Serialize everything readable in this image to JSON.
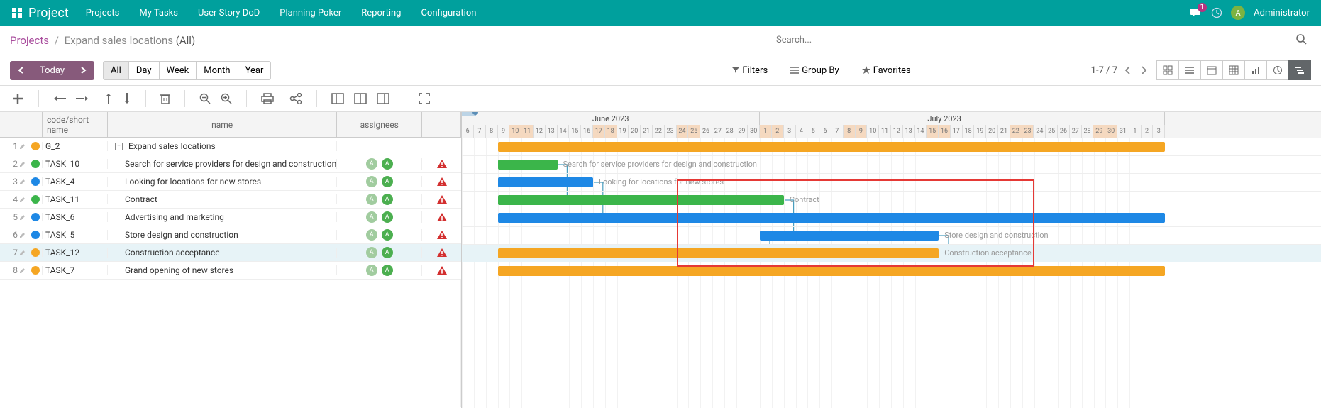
{
  "app": {
    "name": "Project"
  },
  "nav": {
    "links": [
      "Projects",
      "My Tasks",
      "User Story DoD",
      "Planning Poker",
      "Reporting",
      "Configuration"
    ],
    "msg_count": "1",
    "user_initial": "A",
    "user_name": "Administrator"
  },
  "breadcrumb": {
    "root": "Projects",
    "current": "Expand sales locations",
    "suffix": "(All)"
  },
  "search": {
    "placeholder": "Search..."
  },
  "controls": {
    "today": "Today",
    "ranges": [
      "All",
      "Day",
      "Week",
      "Month",
      "Year"
    ],
    "filters": "Filters",
    "groupby": "Group By",
    "favorites": "Favorites",
    "pager": "1-7 / 7"
  },
  "columns": {
    "code": "code/short name",
    "name": "name",
    "assignees": "assignees"
  },
  "months": [
    {
      "label": "June 2023",
      "days": 25
    },
    {
      "label": "July 2023",
      "days": 31
    },
    {
      "label": "",
      "days": 3
    }
  ],
  "timeline_start_day_label": "6",
  "days": [
    {
      "n": "6",
      "w": false
    },
    {
      "n": "7",
      "w": false
    },
    {
      "n": "8",
      "w": false
    },
    {
      "n": "9",
      "w": false
    },
    {
      "n": "10",
      "w": true
    },
    {
      "n": "11",
      "w": true
    },
    {
      "n": "12",
      "w": false
    },
    {
      "n": "13",
      "w": false
    },
    {
      "n": "14",
      "w": false
    },
    {
      "n": "15",
      "w": false
    },
    {
      "n": "16",
      "w": false
    },
    {
      "n": "17",
      "w": true
    },
    {
      "n": "18",
      "w": true
    },
    {
      "n": "19",
      "w": false
    },
    {
      "n": "20",
      "w": false
    },
    {
      "n": "21",
      "w": false
    },
    {
      "n": "22",
      "w": false
    },
    {
      "n": "23",
      "w": false
    },
    {
      "n": "24",
      "w": true
    },
    {
      "n": "25",
      "w": true
    },
    {
      "n": "26",
      "w": false
    },
    {
      "n": "27",
      "w": false
    },
    {
      "n": "28",
      "w": false
    },
    {
      "n": "29",
      "w": false
    },
    {
      "n": "30",
      "w": false
    },
    {
      "n": "1",
      "w": true
    },
    {
      "n": "2",
      "w": true
    },
    {
      "n": "3",
      "w": false
    },
    {
      "n": "4",
      "w": false
    },
    {
      "n": "5",
      "w": false
    },
    {
      "n": "6",
      "w": false
    },
    {
      "n": "7",
      "w": false
    },
    {
      "n": "8",
      "w": true
    },
    {
      "n": "9",
      "w": true
    },
    {
      "n": "10",
      "w": false
    },
    {
      "n": "11",
      "w": false
    },
    {
      "n": "12",
      "w": false
    },
    {
      "n": "13",
      "w": false
    },
    {
      "n": "14",
      "w": false
    },
    {
      "n": "15",
      "w": true
    },
    {
      "n": "16",
      "w": true
    },
    {
      "n": "17",
      "w": false
    },
    {
      "n": "18",
      "w": false
    },
    {
      "n": "19",
      "w": false
    },
    {
      "n": "20",
      "w": false
    },
    {
      "n": "21",
      "w": false
    },
    {
      "n": "22",
      "w": true
    },
    {
      "n": "23",
      "w": true
    },
    {
      "n": "24",
      "w": false
    },
    {
      "n": "25",
      "w": false
    },
    {
      "n": "26",
      "w": false
    },
    {
      "n": "27",
      "w": false
    },
    {
      "n": "28",
      "w": false
    },
    {
      "n": "29",
      "w": true
    },
    {
      "n": "30",
      "w": true
    },
    {
      "n": "31",
      "w": false
    },
    {
      "n": "1",
      "w": false
    },
    {
      "n": "2",
      "w": false
    },
    {
      "n": "3",
      "w": false
    }
  ],
  "rows": [
    {
      "idx": "1",
      "dot": "orange",
      "code": "G_2",
      "name": "Expand sales locations",
      "is_group": true,
      "assignees": [],
      "alert": false,
      "bar": {
        "color": "orange",
        "start": 3,
        "end": 59,
        "full": true
      }
    },
    {
      "idx": "2",
      "dot": "green",
      "code": "TASK_10",
      "name": "Search for service providers for design and construction",
      "assignees": [
        "light",
        "dark"
      ],
      "alert": true,
      "bar": {
        "color": "green",
        "start": 3,
        "end": 8,
        "label": "Search for service providers for design and construction"
      }
    },
    {
      "idx": "3",
      "dot": "blue",
      "code": "TASK_4",
      "name": "Looking for locations for new stores",
      "assignees": [
        "light",
        "dark"
      ],
      "alert": true,
      "bar": {
        "color": "blue",
        "start": 3,
        "end": 11,
        "label": "Looking for locations for new stores"
      }
    },
    {
      "idx": "4",
      "dot": "green",
      "code": "TASK_11",
      "name": "Contract",
      "assignees": [
        "light",
        "dark"
      ],
      "alert": true,
      "bar": {
        "color": "green",
        "start": 3,
        "end": 27,
        "label": "Contract"
      }
    },
    {
      "idx": "5",
      "dot": "blue",
      "code": "TASK_6",
      "name": "Advertising and marketing",
      "assignees": [
        "light",
        "dark"
      ],
      "alert": true,
      "bar": {
        "color": "blue",
        "start": 3,
        "end": 59,
        "full": true
      }
    },
    {
      "idx": "6",
      "dot": "blue",
      "code": "TASK_5",
      "name": "Store design and construction",
      "assignees": [
        "light",
        "dark"
      ],
      "alert": true,
      "bar": {
        "color": "blue",
        "start": 25,
        "end": 40,
        "label": "Store design and construction"
      }
    },
    {
      "idx": "7",
      "dot": "orange",
      "code": "TASK_12",
      "name": "Construction acceptance",
      "assignees": [
        "light",
        "dark"
      ],
      "alert": true,
      "hover": true,
      "bar": {
        "color": "orange",
        "start": 3,
        "end": 40,
        "label": "Construction acceptance"
      }
    },
    {
      "idx": "8",
      "dot": "orange",
      "code": "TASK_7",
      "name": "Grand opening of new stores",
      "assignees": [
        "light",
        "dark"
      ],
      "alert": true,
      "bar": {
        "color": "orange",
        "start": 3,
        "end": 59,
        "full": true
      }
    }
  ],
  "today_col": 7,
  "highlight": {
    "left_col": 18,
    "right_col": 48,
    "top_row": 2,
    "bottom_row": 6
  }
}
